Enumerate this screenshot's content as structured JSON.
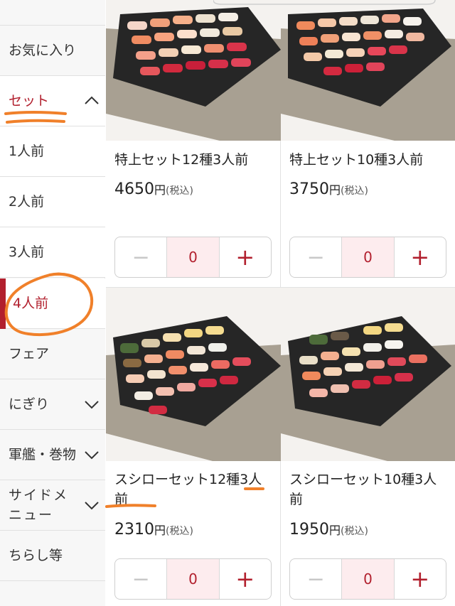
{
  "sidebar": {
    "items": [
      {
        "label": "お気に入り"
      },
      {
        "label": "セット"
      },
      {
        "label": "1人前"
      },
      {
        "label": "2人前"
      },
      {
        "label": "3人前"
      },
      {
        "label": "4人前"
      },
      {
        "label": "フェア"
      },
      {
        "label": "にぎり"
      },
      {
        "label": "軍艦・巻物"
      },
      {
        "label": "サイドメニュー"
      },
      {
        "label": "ちらし等"
      }
    ]
  },
  "products": [
    {
      "name": "特上セット12種3人前",
      "price": "4650",
      "yen": "円",
      "tax": "(税込)",
      "qty": "0"
    },
    {
      "name": "特上セット10種3人前",
      "price": "3750",
      "yen": "円",
      "tax": "(税込)",
      "qty": "0"
    },
    {
      "name": "スシローセット12種3人前",
      "price": "2310",
      "yen": "円",
      "tax": "(税込)",
      "qty": "0"
    },
    {
      "name": "スシローセット10種3人前",
      "price": "1950",
      "yen": "円",
      "tax": "(税込)",
      "qty": "0"
    }
  ],
  "stepper": {
    "minus": "−",
    "plus": "+"
  },
  "colors": {
    "accent": "#b2202e",
    "annotation": "#f0802a",
    "qty_bg": "#fdecee"
  }
}
